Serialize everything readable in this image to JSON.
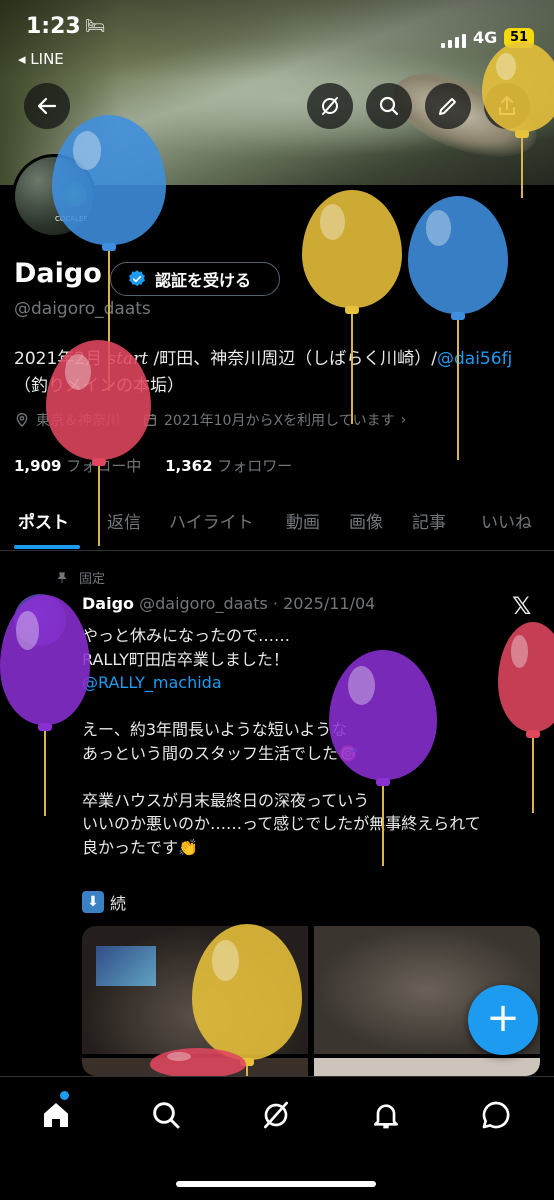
{
  "status_bar": {
    "time": "1:23",
    "back_app": "◂ LINE",
    "network": "4G",
    "battery": "51"
  },
  "profile": {
    "name": "Daigo",
    "verify_label": "認証を受ける",
    "handle": "@daigoro_daats",
    "avatar_sign": "COCALERO",
    "bio_line1_a": "2021年2月 ",
    "bio_line1_b": "start",
    "bio_line1_c": " /町田、神奈川周辺（しばらく川崎）/",
    "bio_mention": "@dai56fj",
    "bio_line2": "（釣りメインの本垢）",
    "location": "東京＆神奈川",
    "joined": "2021年10月からXを利用しています",
    "following_count": "1,909",
    "following_label": " フォロー中",
    "followers_count": "1,362",
    "followers_label": " フォロワー"
  },
  "tabs": [
    "ポスト",
    "返信",
    "ハイライト",
    "動画",
    "画像",
    "記事",
    "いいね"
  ],
  "post": {
    "pinned_label": "固定",
    "author": "Daigo",
    "handle_date": " @daigoro_daats · 2025/11/04",
    "lines": [
      "やっと休みになったので……",
      "RALLY町田店卒業しました！",
      "",
      "",
      "えー、約3年間長いような短いような",
      "あっという間のスタッフ生活でした🎯",
      "",
      "卒業ハウスが月末最終日の深夜っていう",
      "いいのか悪いのか……って感じでしたが無事終えられて",
      "良かったです👏"
    ],
    "mention": "@RALLY_machida",
    "continued": "続",
    "continued_icon": "⬇"
  },
  "icons": {
    "back": "arrow-left-icon",
    "grok": "grok-icon",
    "search": "search-icon",
    "edit": "pencil-icon",
    "share": "share-icon",
    "fab": "+",
    "x_logo": "𝕏"
  },
  "colors": {
    "accent": "#1d9bf0",
    "balloon_blue": "#3f8fe0",
    "balloon_yellow": "#e8c23a",
    "balloon_red": "#e0475f",
    "balloon_purple": "#8a2fd0"
  }
}
